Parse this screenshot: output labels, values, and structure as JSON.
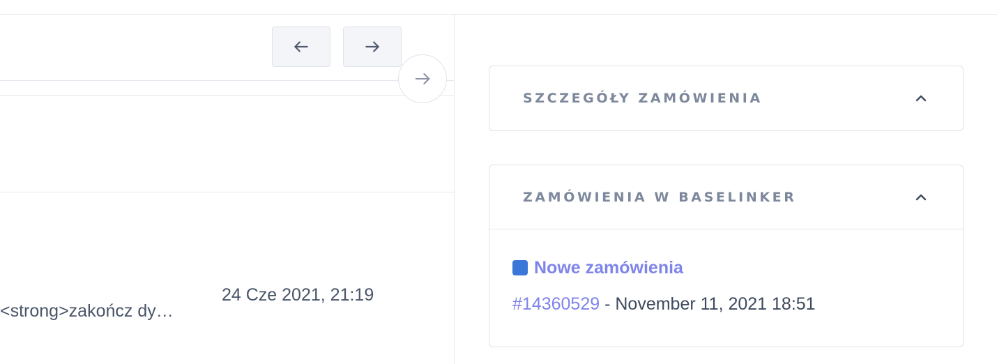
{
  "navigation": {
    "prev_icon": "arrow-left-icon",
    "next_icon": "arrow-right-icon",
    "collapse_icon": "arrow-right-icon"
  },
  "table": {
    "row": {
      "text": "<strong>zakończ dy…",
      "date": "24 Cze 2021, 21:19"
    }
  },
  "sidebar": {
    "order_details": {
      "title": "SZCZEGÓŁY ZAMÓWIENIA",
      "icon": "chevron-up-icon"
    },
    "baselinker": {
      "title": "ZAMÓWIENIA W BASELINKER",
      "icon": "chevron-up-icon",
      "status": {
        "label": "Nowe zamówienia",
        "color": "#3a77d9"
      },
      "order": {
        "number": "#14360529",
        "separator": " - ",
        "date": "November 11, 2021 18:51"
      }
    }
  },
  "colors": {
    "link": "#7f84ea",
    "heading": "#7d889c",
    "text": "#3d4a5c",
    "border": "#dfe3e9"
  }
}
